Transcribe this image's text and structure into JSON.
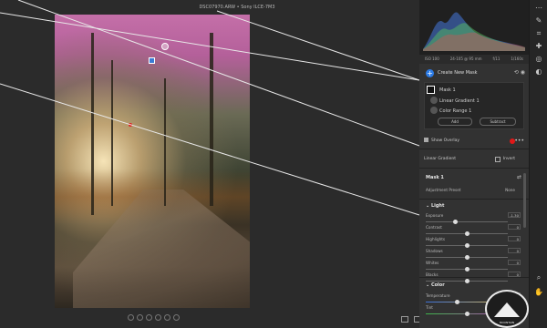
{
  "window": {
    "title": "DSC07970.ARW  •  Sony ILCE-7M3"
  },
  "camera_info": [
    "ISO 100",
    "24-105 @ 95 mm",
    "f/11",
    "1/160s"
  ],
  "masks": {
    "create_label": "Create New Mask",
    "mask_name": "Mask 1",
    "components": [
      "Linear Gradient 1",
      "Color Range 1"
    ],
    "add_label": "Add",
    "subtract_label": "Subtract"
  },
  "overlay": {
    "label": "Show Overlay",
    "color": "#e01818"
  },
  "linear_gradient": {
    "label": "Linear Gradient",
    "invert_label": "Invert"
  },
  "mask_section": {
    "title": "Mask 1",
    "preset_label": "Adjustment Preset",
    "preset_value": "None"
  },
  "light": {
    "title": "Light",
    "sliders": [
      {
        "label": "Exposure",
        "value": "-1.30",
        "level": 0.35
      },
      {
        "label": "Contrast",
        "value": "0",
        "level": 0.5
      },
      {
        "label": "Highlights",
        "value": "0",
        "level": 0.5
      },
      {
        "label": "Shadows",
        "value": "0",
        "level": 0.5
      },
      {
        "label": "Whites",
        "value": "0",
        "level": 0.5
      },
      {
        "label": "Blacks",
        "value": "0",
        "level": 0.5
      }
    ]
  },
  "color": {
    "title": "Color",
    "sliders": [
      {
        "label": "Temperature",
        "value": "-25",
        "level": 0.38
      },
      {
        "label": "Tint",
        "value": "0",
        "level": 0.5
      }
    ]
  },
  "toolbar": {
    "tools": [
      "more-icon",
      "edit-icon",
      "crop-icon",
      "heal-icon",
      "redeye-icon",
      "mask-icon",
      "zoom-icon",
      "hand-icon"
    ]
  },
  "logo": {
    "text": "MOUNTAIN"
  }
}
